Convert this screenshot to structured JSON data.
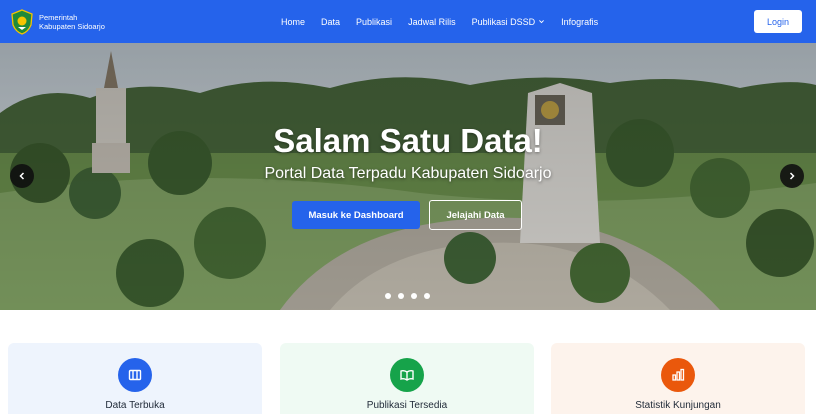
{
  "header": {
    "brand_line1": "Pemerintah",
    "brand_line2": "Kabupaten Sidoarjo",
    "nav": [
      "Home",
      "Data",
      "Publikasi",
      "Jadwal Rilis",
      "Publikasi DSSD",
      "Infografis"
    ],
    "login_label": "Login"
  },
  "hero": {
    "title": "Salam Satu Data!",
    "subtitle": "Portal Data Terpadu Kabupaten Sidoarjo",
    "primary_button": "Masuk ke Dashboard",
    "secondary_button": "Jelajahi Data",
    "slide_count": 4
  },
  "cards": [
    {
      "label": "Data Terbuka",
      "icon": "book-icon",
      "color": "#2563eb",
      "bg": "#eef4fd"
    },
    {
      "label": "Publikasi Tersedia",
      "icon": "open-book-icon",
      "color": "#16a34a",
      "bg": "#effaf3"
    },
    {
      "label": "Statistik Kunjungan",
      "icon": "chart-icon",
      "color": "#ea580c",
      "bg": "#fdf3ec"
    }
  ],
  "colors": {
    "brand": "#2563eb"
  }
}
